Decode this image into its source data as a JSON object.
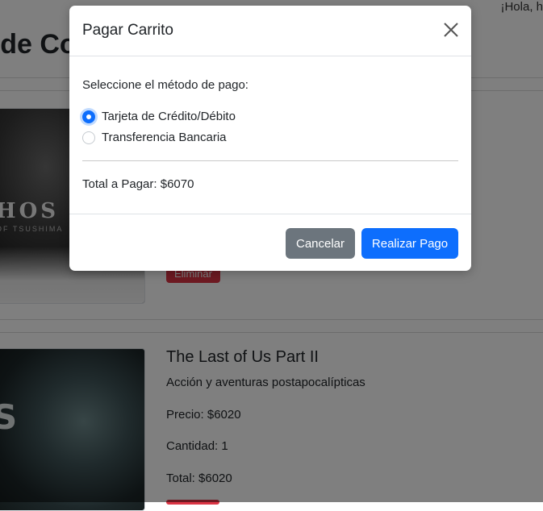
{
  "header": {
    "greeting": "¡Hola, h",
    "page_title": "o de Co"
  },
  "items": [
    {
      "image_text": "HOS",
      "image_subtext": "OF TSUSHIMA",
      "delete_label": "Eliminar"
    },
    {
      "title": "The Last of Us Part II",
      "genre": "Acción y aventuras postapocalípticas",
      "price": "Precio: $6020",
      "quantity": "Cantidad: 1",
      "total": "Total: $6020",
      "image_text": "S"
    }
  ],
  "modal": {
    "title": "Pagar Carrito",
    "prompt": "Seleccione el método de pago:",
    "options": [
      {
        "label": "Tarjeta de Crédito/Débito",
        "checked": true
      },
      {
        "label": "Transferencia Bancaria",
        "checked": false
      }
    ],
    "total": "Total a Pagar: $6070",
    "cancel_label": "Cancelar",
    "pay_label": "Realizar Pago"
  },
  "colors": {
    "primary": "#0d6efd",
    "secondary": "#6c757d",
    "danger": "#dc3545"
  }
}
